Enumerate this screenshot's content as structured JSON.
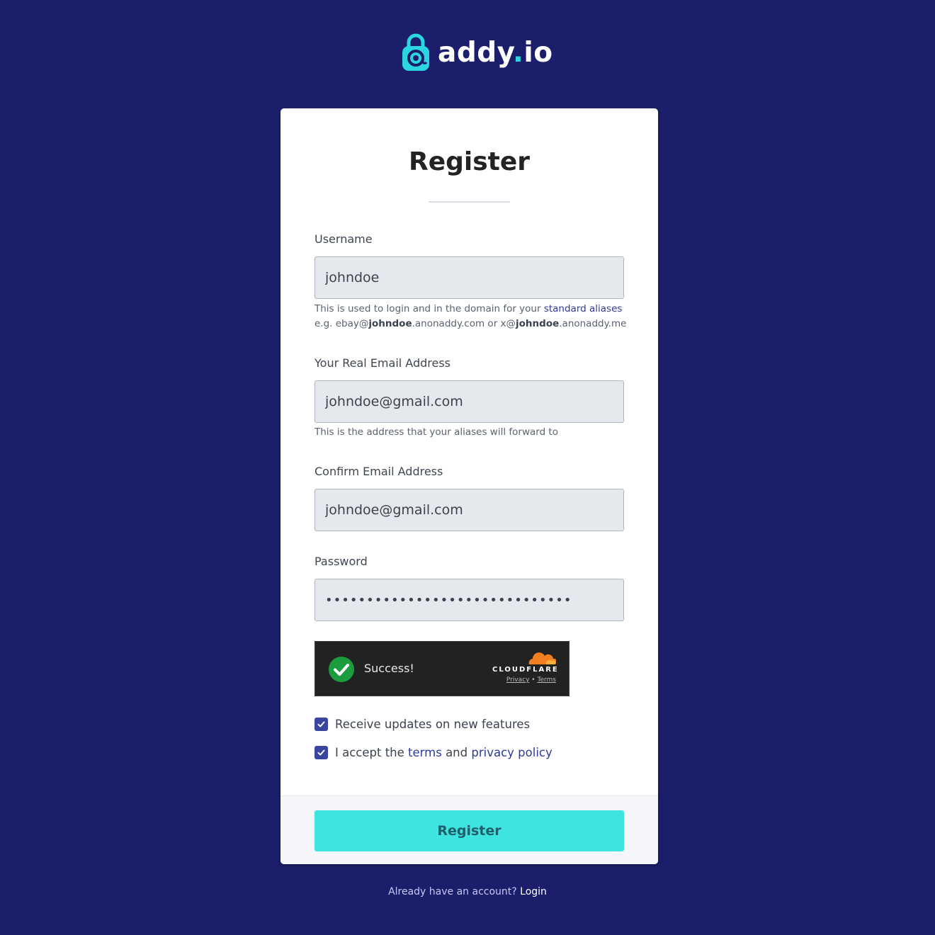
{
  "brand": {
    "name_part1": "addy",
    "name_dot": ".",
    "name_part2": "io",
    "accent_color": "#2bd6e0",
    "background_color": "#1b1f6b"
  },
  "form": {
    "title": "Register",
    "username": {
      "label": "Username",
      "value": "johndoe",
      "help_prefix": "This is used to login and in the domain for your ",
      "help_link": "standard aliases",
      "example_prefix": "e.g. ebay@",
      "example_user1": "johndoe",
      "example_domain1": ".anonaddy.com or x@",
      "example_user2": "johndoe",
      "example_domain2": ".anonaddy.me"
    },
    "email": {
      "label": "Your Real Email Address",
      "value": "johndoe@gmail.com",
      "help": "This is the address that your aliases will forward to"
    },
    "confirm_email": {
      "label": "Confirm Email Address",
      "value": "johndoe@gmail.com"
    },
    "password": {
      "label": "Password",
      "value": "••••••••••••••••••••••••••••••"
    },
    "captcha": {
      "status": "Success!",
      "provider": "CLOUDFLARE",
      "privacy": "Privacy",
      "separator": "•",
      "terms": "Terms"
    },
    "updates_checkbox": {
      "label": "Receive updates on new features",
      "checked": true
    },
    "terms_checkbox": {
      "prefix": "I accept the ",
      "terms_link": "terms",
      "middle": " and ",
      "privacy_link": "privacy policy",
      "checked": true
    },
    "submit_label": "Register",
    "submit_color": "#3de4e0"
  },
  "footer": {
    "prompt": "Already have an account?",
    "login_link": "Login"
  }
}
